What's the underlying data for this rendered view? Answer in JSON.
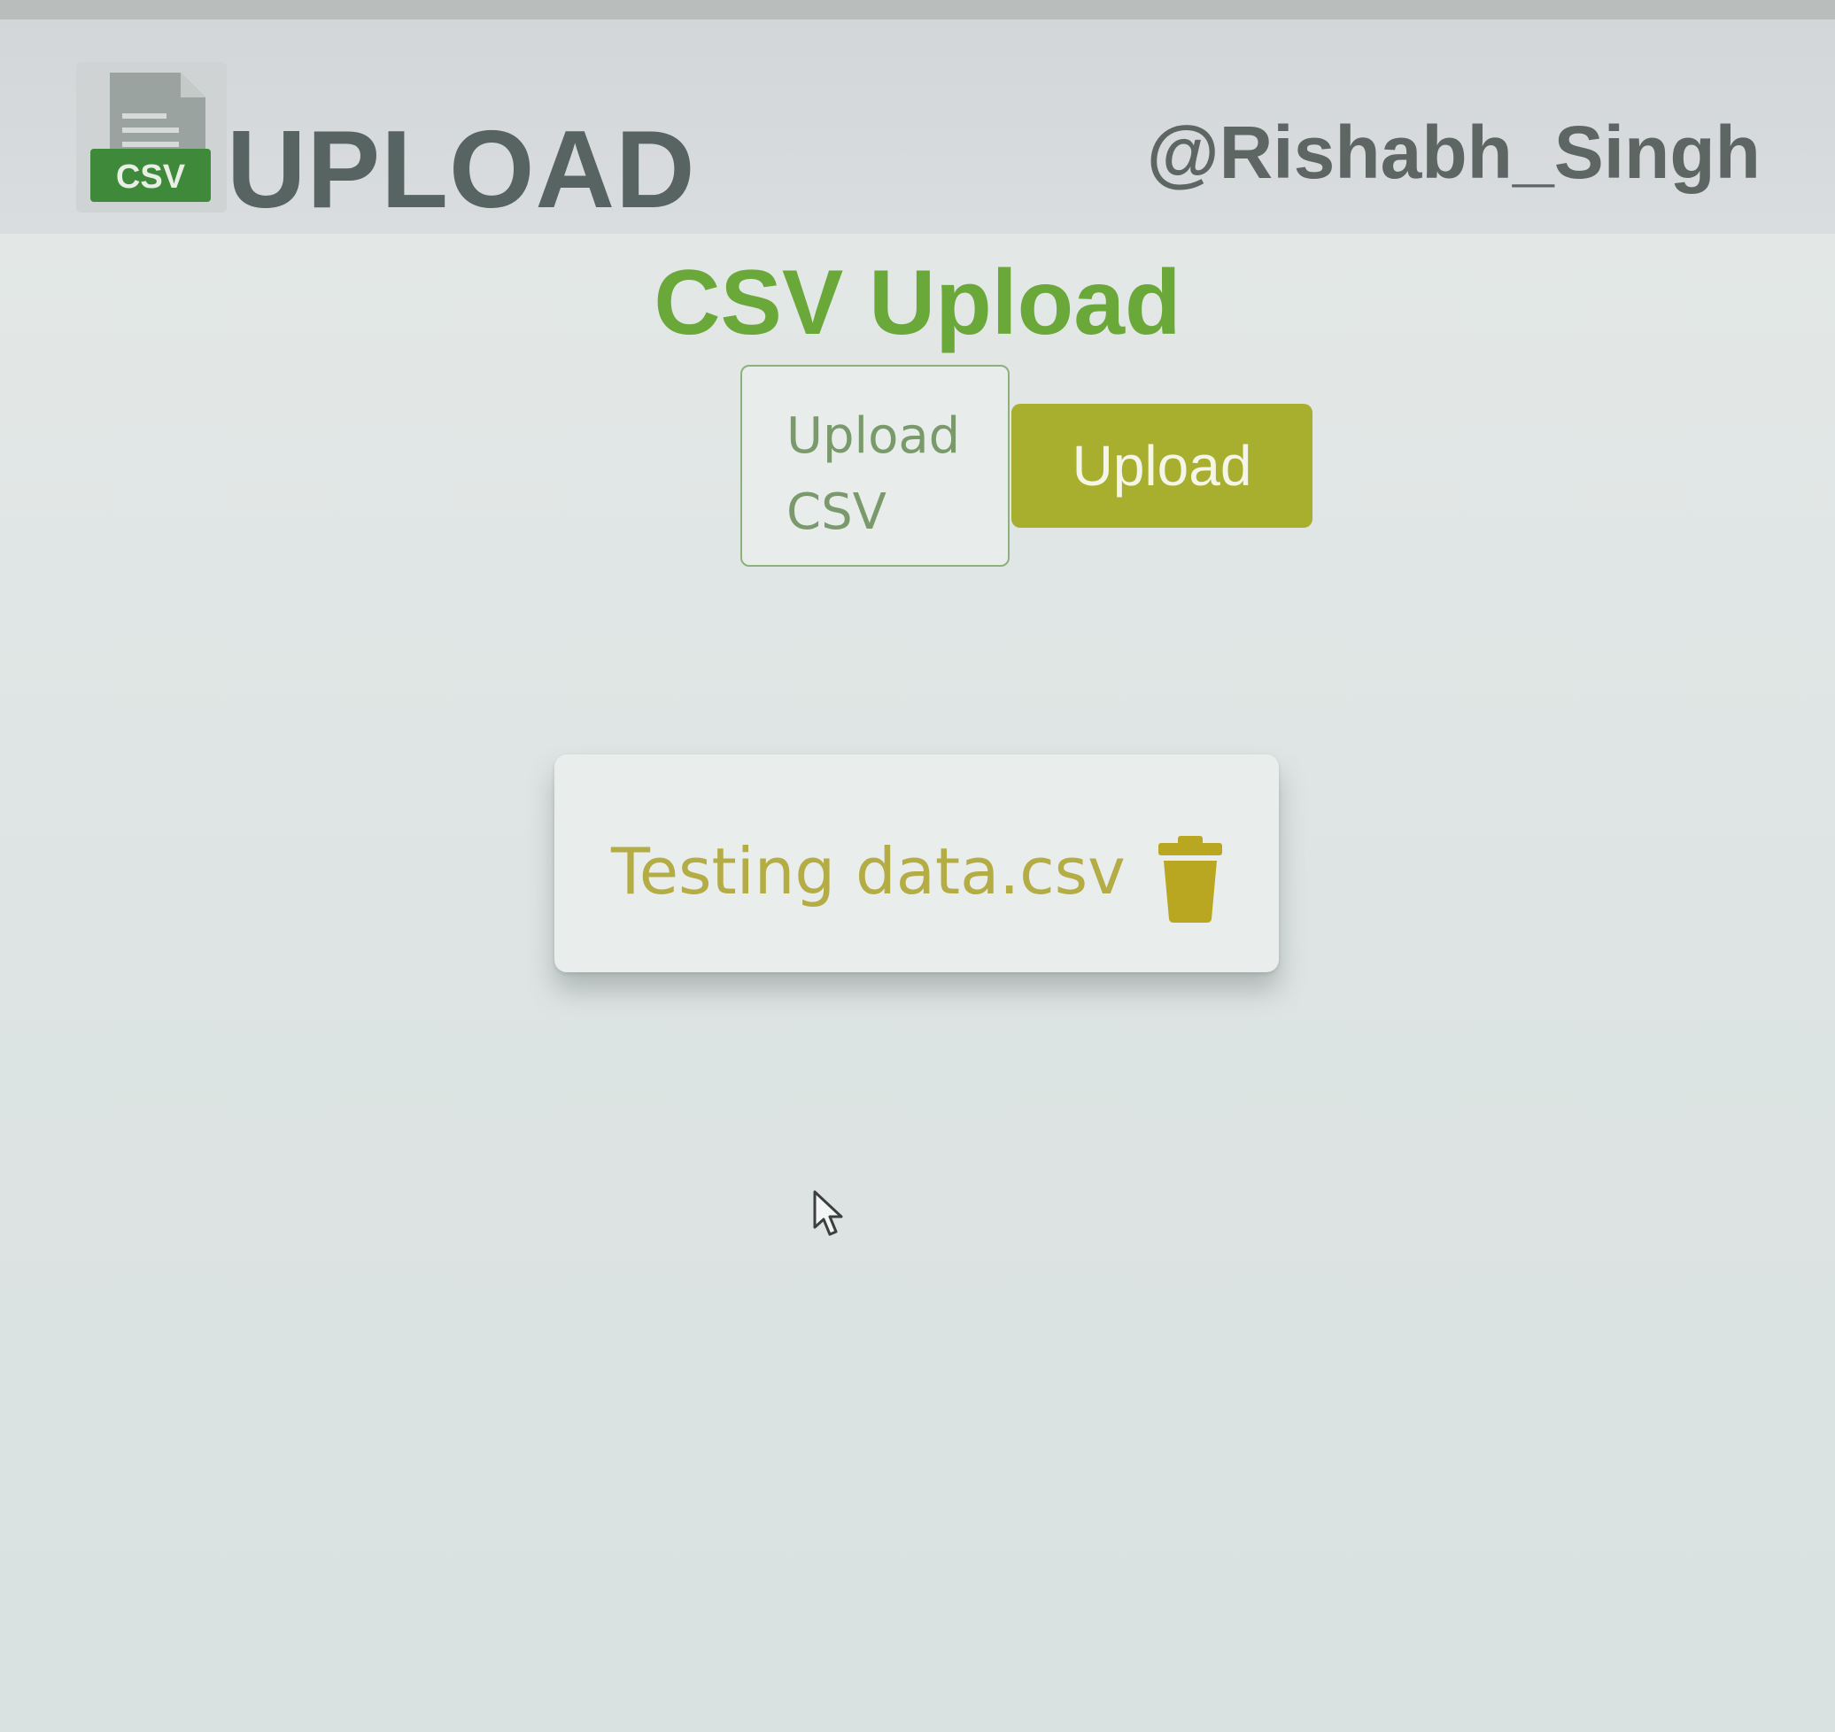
{
  "header": {
    "logo_badge": "CSV",
    "brand": "UPLOAD",
    "username": "@Rishabh_Singh"
  },
  "main": {
    "title": "CSV Upload",
    "file_picker_label": "Upload CSV",
    "upload_button": "Upload"
  },
  "files": [
    {
      "name": "Testing data.csv",
      "action_icon": "trash-icon"
    }
  ],
  "colors": {
    "accent_green": "#6ba83a",
    "upload_button": "#a8ae2d",
    "file_text": "#b4ac45",
    "header_text": "#586461"
  }
}
